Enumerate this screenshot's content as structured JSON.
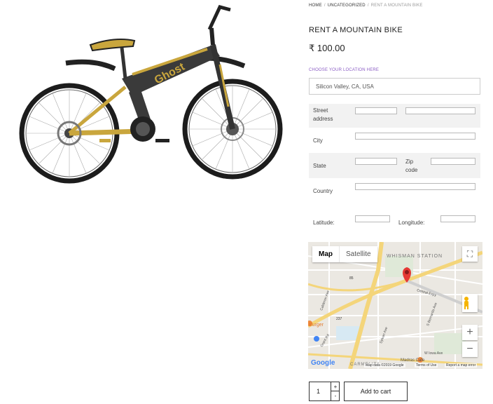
{
  "breadcrumb": {
    "items": [
      "HOME",
      "UNCATEGORIZED",
      "RENT A MOUNTAIN BIKE"
    ],
    "separator": "/"
  },
  "product": {
    "title": "RENT A MOUNTAIN BIKE",
    "price": "₹ 100.00"
  },
  "location": {
    "label": "CHOOSE YOUR LOCATION HERE",
    "value": "Silicon Valley, CA, USA"
  },
  "address": {
    "street_label": "Street address",
    "city_label": "City",
    "state_label": "State",
    "zip_label": "Zip code",
    "country_label": "Country",
    "latitude_label": "Latitude:",
    "longitude_label": "Longitude:"
  },
  "map": {
    "type_map": "Map",
    "type_satellite": "Satellite",
    "station_label": "WHISMAN STATION",
    "road_central": "Central Expy",
    "road_madras": "Madras Cafe",
    "road_carmelita": "CARMELITA",
    "road_iowa": "W Iowa Ave",
    "road_bernardo": "S Bernardo Ave",
    "road_calderon": "Calderon Ave",
    "road_grant": "Grant Rd",
    "road_sylvan": "Sylvan Ave",
    "burger": "Burger",
    "route_85": "85",
    "route_237": "237",
    "zoom_in": "+",
    "zoom_out": "−",
    "fullscreen": "⛶",
    "google": "Google",
    "attribution": "Map data ©2019 Google",
    "terms": "Terms of Use",
    "report": "Report a map error",
    "pin_color": "#e53935"
  },
  "cart": {
    "quantity": "1",
    "plus": "+",
    "minus": "-",
    "add_label": "Add to cart"
  },
  "image": {
    "brand_text": "Ghost",
    "frame_color": "#3a3a3a",
    "accent_color": "#c9a63d"
  }
}
